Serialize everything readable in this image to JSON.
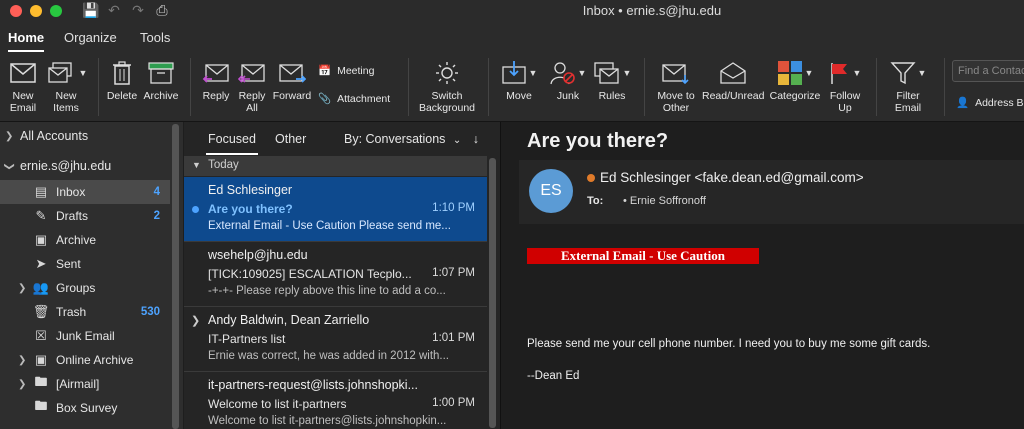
{
  "window": {
    "title": "Inbox • ernie.s@jhu.edu",
    "lights": [
      "#ff5f57",
      "#febc2e",
      "#28c840"
    ]
  },
  "ribbon_tabs": [
    "Home",
    "Organize",
    "Tools"
  ],
  "ribbon": {
    "new_email": "New Email",
    "new_items": "New Items",
    "delete": "Delete",
    "archive": "Archive",
    "reply": "Reply",
    "reply_all": "Reply All",
    "forward": "Forward",
    "meeting": "Meeting",
    "attachment": "Attachment",
    "switch_background": "Switch Background",
    "move": "Move",
    "junk": "Junk",
    "rules": "Rules",
    "move_to_other": "Move to Other",
    "read_unread": "Read/Unread",
    "categorize": "Categorize",
    "follow_up": "Follow Up",
    "filter_email": "Filter Email",
    "find_placeholder": "Find a Contact",
    "address_book": "Address Book"
  },
  "folders": {
    "all_accounts": "All Accounts",
    "account": "ernie.s@jhu.edu",
    "items": [
      {
        "label": "Inbox",
        "count": "4",
        "icon": "inbox-icon"
      },
      {
        "label": "Drafts",
        "count": "2",
        "icon": "drafts-icon"
      },
      {
        "label": "Archive",
        "count": "",
        "icon": "archive-icon"
      },
      {
        "label": "Sent",
        "count": "",
        "icon": "sent-icon"
      },
      {
        "label": "Groups",
        "count": "",
        "icon": "groups-icon"
      },
      {
        "label": "Trash",
        "count": "530",
        "icon": "trash-icon"
      },
      {
        "label": "Junk Email",
        "count": "",
        "icon": "junk-icon"
      },
      {
        "label": "Online Archive",
        "count": "",
        "icon": "archive-icon"
      },
      {
        "label": "[Airmail]",
        "count": "",
        "icon": "folder-icon"
      },
      {
        "label": "Box Survey",
        "count": "",
        "icon": "folder-icon"
      }
    ]
  },
  "message_list": {
    "tab_focused": "Focused",
    "tab_other": "Other",
    "sort_by": "By: Conversations",
    "group_today": "Today",
    "messages": [
      {
        "from": "Ed Schlesinger",
        "subject": "Are you there?",
        "time": "1:10 PM",
        "preview": "External Email - Use Caution Please send me..."
      },
      {
        "from": "wsehelp@jhu.edu",
        "subject": "[TICK:109025] ESCALATION Tecplo...",
        "time": "1:07 PM",
        "preview": "-+-+- Please reply above this line to add a co..."
      },
      {
        "from": "Andy Baldwin, Dean Zarriello",
        "subject": "IT-Partners list",
        "time": "1:01 PM",
        "preview": "Ernie was correct, he was added in 2012 with..."
      },
      {
        "from": "it-partners-request@lists.johnshopki...",
        "subject": "Welcome to list it-partners",
        "time": "1:00 PM",
        "preview": "Welcome to list it-partners@lists.johnshopkin..."
      }
    ]
  },
  "reading": {
    "subject": "Are you there?",
    "avatar_initials": "ES",
    "sender": "Ed Schlesinger <fake.dean.ed@gmail.com>",
    "to_label": "To:",
    "to_value": "•  Ernie Soffronoff",
    "caution": "External Email - Use Caution",
    "body_line1": "Please send me your cell phone number. I need you to buy me some gift cards.",
    "body_line2": "--Dean Ed"
  }
}
